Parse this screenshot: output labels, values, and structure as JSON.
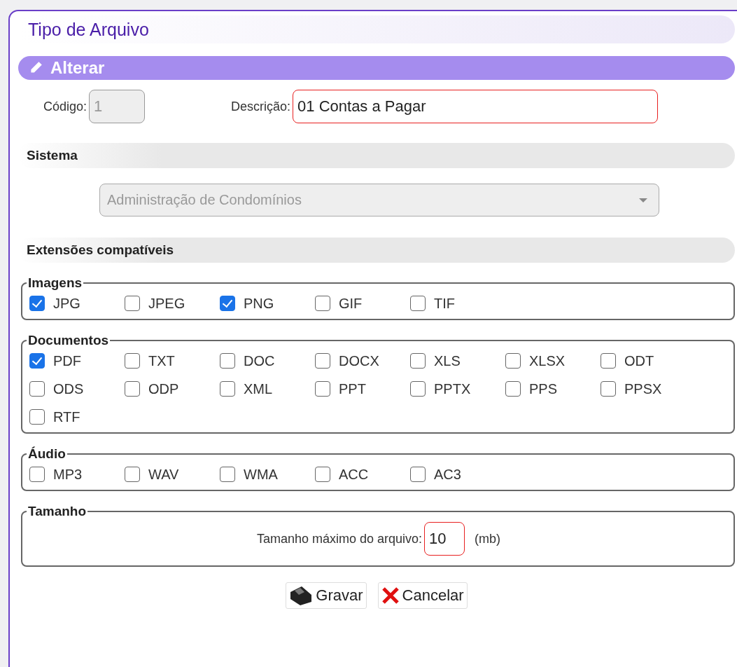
{
  "panel": {
    "title": "Tipo de Arquivo"
  },
  "mode_bar": {
    "label": "Alterar"
  },
  "codigo": {
    "label": "Código:",
    "value": "1",
    "disabled": true
  },
  "descricao": {
    "label": "Descrição:",
    "value": "01 Contas a Pagar"
  },
  "sistema": {
    "heading": "Sistema",
    "value": "Administração de Condomínios",
    "disabled": true
  },
  "extensoes": {
    "heading": "Extensões compatíveis",
    "groups": [
      {
        "legend": "Imagens",
        "items": [
          {
            "label": "JPG",
            "checked": true
          },
          {
            "label": "JPEG",
            "checked": false
          },
          {
            "label": "PNG",
            "checked": true
          },
          {
            "label": "GIF",
            "checked": false
          },
          {
            "label": "TIF",
            "checked": false
          }
        ]
      },
      {
        "legend": "Documentos",
        "items": [
          {
            "label": "PDF",
            "checked": true
          },
          {
            "label": "TXT",
            "checked": false
          },
          {
            "label": "DOC",
            "checked": false
          },
          {
            "label": "DOCX",
            "checked": false
          },
          {
            "label": "XLS",
            "checked": false
          },
          {
            "label": "XLSX",
            "checked": false
          },
          {
            "label": "ODT",
            "checked": false
          },
          {
            "label": "ODS",
            "checked": false
          },
          {
            "label": "ODP",
            "checked": false
          },
          {
            "label": "XML",
            "checked": false
          },
          {
            "label": "PPT",
            "checked": false
          },
          {
            "label": "PPTX",
            "checked": false
          },
          {
            "label": "PPS",
            "checked": false
          },
          {
            "label": "PPSX",
            "checked": false
          },
          {
            "label": "RTF",
            "checked": false
          }
        ]
      },
      {
        "legend": "Áudio",
        "items": [
          {
            "label": "MP3",
            "checked": false
          },
          {
            "label": "WAV",
            "checked": false
          },
          {
            "label": "WMA",
            "checked": false
          },
          {
            "label": "ACC",
            "checked": false
          },
          {
            "label": "AC3",
            "checked": false
          }
        ]
      }
    ]
  },
  "tamanho": {
    "legend": "Tamanho",
    "label": "Tamanho máximo do arquivo:",
    "value": "10",
    "unit": "(mb)"
  },
  "buttons": [
    {
      "kind": "save",
      "label": "Gravar"
    },
    {
      "kind": "cancel",
      "label": "Cancelar"
    }
  ]
}
